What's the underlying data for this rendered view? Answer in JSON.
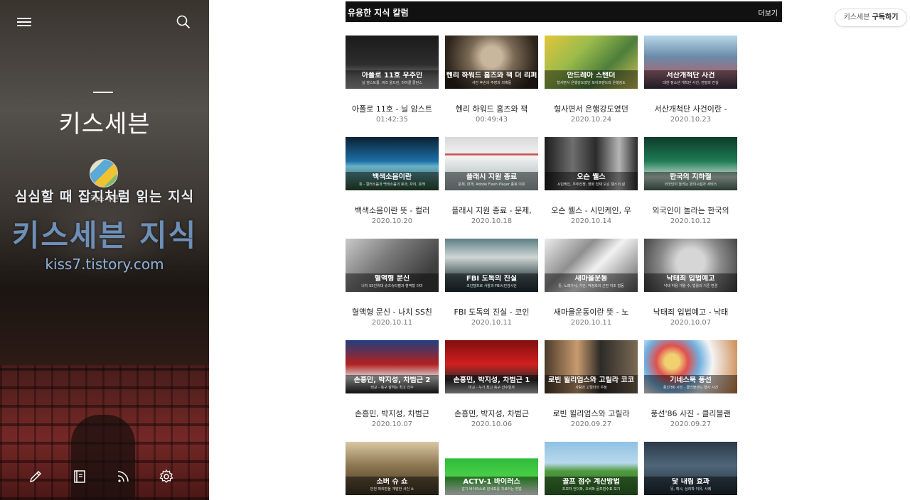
{
  "sidebar": {
    "blog_title": "키스세븐",
    "owner_name": "키스세븐",
    "banner": {
      "tagline": "심심할 때 잡지처럼 읽는 지식",
      "name": "키스세븐 지식",
      "url": "kiss7.tistory.com"
    },
    "icons": [
      "menu-icon",
      "search-icon",
      "pencil-icon",
      "notebook-icon",
      "rss-icon",
      "gear-icon"
    ]
  },
  "subscribe": {
    "name": "키스세븐",
    "action": "구독하기"
  },
  "section": {
    "title": "유용한 지식 칼럼",
    "more": "더보기"
  },
  "cards": [
    {
      "thumb_title": "아폴로 11호 우주인",
      "thumb_sub": "닐 암스트롱, 버즈 올드린, 마이클 콜린스",
      "title": "아폴로 11호 - 닐 암스트",
      "date": "01:42:35"
    },
    {
      "thumb_title": "헨리 하워드 홈즈와 잭 더 리퍼",
      "thumb_sub": "사진 후손의 주장과 의혹들",
      "title": "헨리 하워드 홈즈와 잭",
      "date": "00:49:43"
    },
    {
      "thumb_title": "안드레아 스탠더",
      "thumb_sub": "형사면서 은행강도였던 보이프렌드와 은행강도",
      "title": "형사면서 은행강도였던",
      "date": "2020.10.24"
    },
    {
      "thumb_title": "서산개척단 사건",
      "thumb_sub": "대한 정소년 개척단 사건, 전말과 진실",
      "title": "서산개척단 사건이란 -",
      "date": "2020.10.23"
    },
    {
      "thumb_title": "백색소음이란",
      "thumb_sub": "뜻 - 컬러소음과 백색소음의 효과, 차이, 유래",
      "title": "백색소음이란 뜻 - 컬러",
      "date": "2020.10.20"
    },
    {
      "thumb_title": "플래시 지원 종료",
      "thumb_sub": "문제, 대책, Adobe Flash Player 종료 이유",
      "title": "플래시 지원 종료 - 문제,",
      "date": "2020.10.18"
    },
    {
      "thumb_title": "오슨 웰스",
      "thumb_sub": "시민케인, 우주전쟁, 영화 천재 오슨 웰스의 삶",
      "title": "오슨 웰스 - 시민케인, 우",
      "date": "2020.10.14"
    },
    {
      "thumb_title": "한국의 지하철",
      "thumb_sub": "외국인이 놀라는 편의시설과 서비스",
      "title": "외국인이 놀라는 한국의",
      "date": "2020.10.12"
    },
    {
      "thumb_title": "혈액형 문신",
      "thumb_sub": "나치 SS친위대 슈츠슈타펠과 혈액형 의미",
      "title": "혈액형 문신 - 나치 SS친",
      "date": "2020.10.11"
    },
    {
      "thumb_title": "FBI 도독의 진실",
      "thumb_sub": "코인텔프로 사찰과 FBI시민감시단",
      "title": "FBI 도독의 진실 - 코인",
      "date": "2020.10.11"
    },
    {
      "thumb_title": "새마을운동",
      "thumb_sub": "뜻, 노래가사, 기간, 박정희의 근면 자조 협동",
      "title": "새마을운동이란 뜻 - 노",
      "date": "2020.10.11"
    },
    {
      "thumb_title": "낙태죄 입법예고",
      "thumb_sub": "낙태 허용 개월 수, 법률의 기준 변경",
      "title": "낙태죄 입법예고 - 낙태",
      "date": "2020.10.07"
    },
    {
      "thumb_title": "손흥민, 박지성, 차범근 2",
      "thumb_sub": "비교 - 축구 잘하는 최고 선수",
      "title": "손흥민, 박지성, 차범근",
      "date": "2020.10.07"
    },
    {
      "thumb_title": "손흥민, 박지성, 차범근 1",
      "thumb_sub": "비교 - 누가 최고 축구 선수일까",
      "title": "손흥민, 박지성, 차범근",
      "date": "2020.10.06"
    },
    {
      "thumb_title": "로빈 윌리엄스와 고릴라 코코",
      "thumb_sub": "사람과 고릴라의 우정",
      "title": "로빈 윌리엄스와 고릴라",
      "date": "2020.09.27"
    },
    {
      "thumb_title": "기네스북 풍선",
      "thumb_sub": "풍선'86 사진 - 클리블랜드 행사 사건",
      "title": "풍선'86 사진 - 클리블랜",
      "date": "2020.09.27"
    },
    {
      "thumb_title": "소버 슈 쇼",
      "thumb_sub": "안전 머리핀을 개발한 사건 소",
      "title": "",
      "date": ""
    },
    {
      "thumb_title": "ACTV-1 바이러스",
      "thumb_sub": "감기 바이러스로 암세포를 치료하는 방법",
      "title": "",
      "date": ""
    },
    {
      "thumb_title": "골프 점수 계산방법",
      "thumb_sub": "초보자 언더파, 오버파 골프점수표 보기",
      "title": "",
      "date": ""
    },
    {
      "thumb_title": "닻 내림 효과",
      "thumb_sub": "뜻, 예시, 심리학 이유, 사례",
      "title": "",
      "date": ""
    }
  ]
}
